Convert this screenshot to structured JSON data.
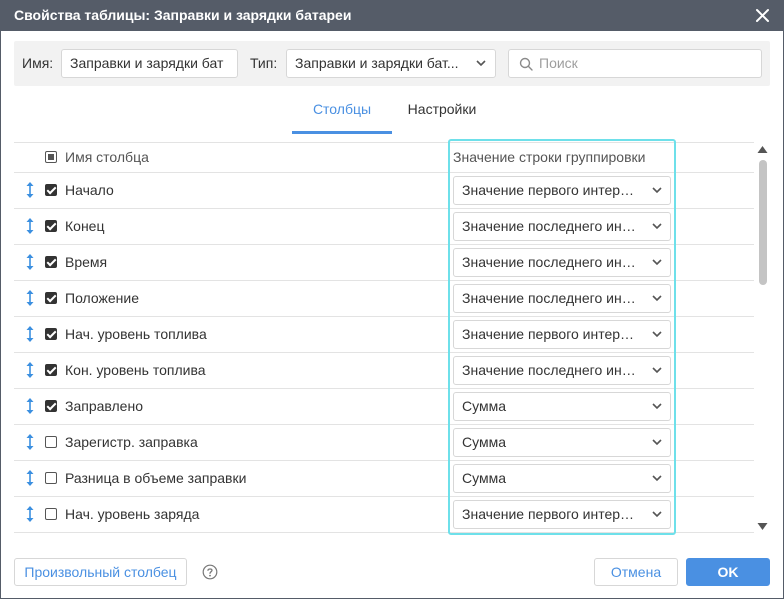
{
  "dialog": {
    "title": "Свойства таблицы: Заправки и зарядки батареи",
    "close_icon": "close-icon"
  },
  "toolbar": {
    "name_label": "Имя:",
    "name_value": "Заправки и зарядки бат",
    "type_label": "Тип:",
    "type_value": "Заправки и зарядки бат...",
    "search_placeholder": "Поиск"
  },
  "tabs": [
    {
      "label": "Столбцы",
      "active": true
    },
    {
      "label": "Настройки",
      "active": false
    }
  ],
  "columns_header": {
    "name": "Имя столбца",
    "grouping": "Значение строки группировки"
  },
  "rows": [
    {
      "name": "Начало",
      "checked": true,
      "grouping": "Значение первого интервала"
    },
    {
      "name": "Конец",
      "checked": true,
      "grouping": "Значение последнего интервала"
    },
    {
      "name": "Время",
      "checked": true,
      "grouping": "Значение последнего интервала"
    },
    {
      "name": "Положение",
      "checked": true,
      "grouping": "Значение последнего интервала"
    },
    {
      "name": "Нач. уровень топлива",
      "checked": true,
      "grouping": "Значение первого интервала"
    },
    {
      "name": "Кон. уровень топлива",
      "checked": true,
      "grouping": "Значение последнего интервала"
    },
    {
      "name": "Заправлено",
      "checked": true,
      "grouping": "Сумма"
    },
    {
      "name": "Зарегистр. заправка",
      "checked": false,
      "grouping": "Сумма"
    },
    {
      "name": "Разница в объеме заправки",
      "checked": false,
      "grouping": "Сумма"
    },
    {
      "name": "Нач. уровень заряда",
      "checked": false,
      "grouping": "Значение первого интервала"
    }
  ],
  "footer": {
    "custom_column": "Произвольный столбец",
    "cancel": "Отмена",
    "ok": "OK"
  },
  "colors": {
    "titlebar": "#555c68",
    "accent": "#4a90e2",
    "highlight": "#6ee0ea",
    "toolbar_bg": "#f2f2f2"
  }
}
